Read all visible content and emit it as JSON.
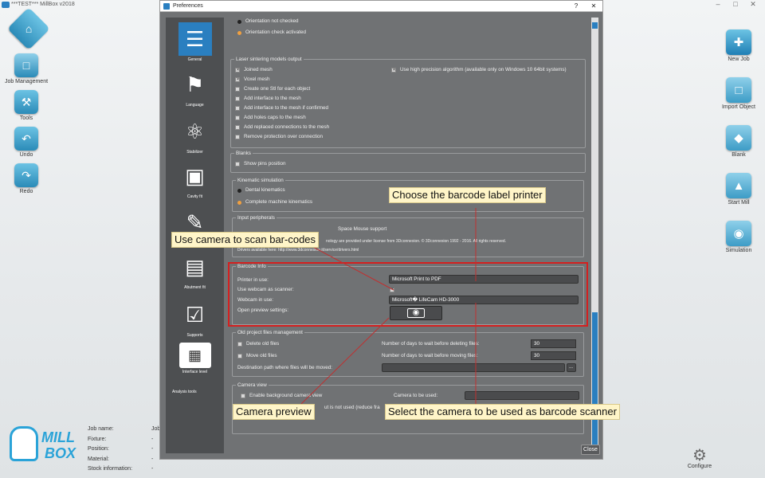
{
  "app": {
    "title": "***TEST*** MillBox v2018"
  },
  "window_controls": [
    "–",
    "□",
    "✕"
  ],
  "left_toolbar": [
    {
      "label": "",
      "icon": "home-icon"
    },
    {
      "label": "Job Management",
      "icon": "job-management-icon"
    },
    {
      "label": "Tools",
      "icon": "tools-icon"
    },
    {
      "label": "Undo",
      "icon": "undo-icon"
    },
    {
      "label": "Redo",
      "icon": "redo-icon"
    }
  ],
  "right_toolbar": [
    {
      "label": "New Job",
      "icon": "new-job-icon"
    },
    {
      "label": "Import Object",
      "icon": "import-object-icon"
    },
    {
      "label": "Blank",
      "icon": "blank-icon"
    },
    {
      "label": "Start Mill",
      "icon": "start-mill-icon"
    },
    {
      "label": "Simulation",
      "icon": "simulation-icon"
    }
  ],
  "job_info": [
    {
      "key": "Job name:",
      "value": "Job"
    },
    {
      "key": "Fixture:",
      "value": "-"
    },
    {
      "key": "Position:",
      "value": "-"
    },
    {
      "key": "Material:",
      "value": "-"
    },
    {
      "key": "Stock information:",
      "value": "-"
    }
  ],
  "logo": {
    "line1": "MILL",
    "line2": "BOX"
  },
  "configure": {
    "label": "Configure"
  },
  "dialog": {
    "title": "Preferences",
    "help": "?",
    "close_x": "✕",
    "close_button": "Close",
    "nav": [
      {
        "label": "General",
        "icon": "sliders-icon"
      },
      {
        "label": "Language",
        "icon": "flag-icon"
      },
      {
        "label": "Stabilizer",
        "icon": "stabilizer-icon"
      },
      {
        "label": "Cavity fit",
        "icon": "cavity-fit-icon"
      },
      {
        "label": "",
        "icon": "pencil-box-icon"
      },
      {
        "label": "Abutment fit",
        "icon": "abutment-icon"
      },
      {
        "label": "Supports",
        "icon": "supports-icon"
      },
      {
        "label": "Interface level",
        "icon": "interface-level-icon"
      },
      {
        "label": "Analysis tools",
        "icon": ""
      }
    ],
    "orientation": {
      "not_checked": "Orientation not checked",
      "activated": "Orientation check activated"
    },
    "laser": {
      "title": "Laser sintering models output",
      "joined": "Joined mesh",
      "high_precision": "Use high precision algorithm (available only on Windows 10 64bit systems)",
      "voxel": "Voxel mesh",
      "one_stl": "Create one Stl for each object",
      "add_interface": "Add interface to the mesh",
      "add_interface_confirmed": "Add interface to the mesh if confirmed",
      "holes_caps": "Add holes caps to the mesh",
      "replaced_conn": "Add replaced connections to the mesh",
      "remove_protection": "Remove protection over connection"
    },
    "blanks": {
      "title": "Blanks",
      "show_pins": "Show pins position"
    },
    "kinematic": {
      "title": "Kinematic simulation",
      "dental": "Dental kinematics",
      "complete": "Complete machine kinematics"
    },
    "input": {
      "title": "Input peripherals",
      "support_tail": "Space Mouse support",
      "license_text": "nology are provided under license from 3Dconnexion. © 3Dconnexion 1992 - 2016. All rights reserved.",
      "drivers": "Drivers available here: http://www.3dconnexion.it/service/drivers.html"
    },
    "barcode": {
      "title": "Barcode Info",
      "printer_label": "Printer in use:",
      "printer_value": "Microsoft Print to PDF",
      "webcam_scanner_label": "Use webcam as scanner:",
      "webcam_label": "Webcam in use:",
      "webcam_value": "Microsoft� LifeCam HD-3000",
      "preview_label": "Open preview settings:"
    },
    "old_files": {
      "title": "Old project files management",
      "delete": "Delete old files",
      "delete_days_label": "Number of days to wait before deleting files:",
      "delete_days": "30",
      "move": "Move old files",
      "move_days_label": "Number of days to wait before moving files:",
      "move_days": "30",
      "dest_label": "Destination path where files will be moved:",
      "browse": "..."
    },
    "camera": {
      "title": "Camera view",
      "enable": "Enable background camera view",
      "camera_label": "Camera to be used:",
      "reduce_text": "ut is not used (reduce fra"
    }
  },
  "annotations": {
    "printer": "Choose the barcode label printer",
    "scan": "Use camera to scan bar-codes",
    "preview": "Camera preview",
    "select_camera": "Select the camera to be used as barcode scanner"
  },
  "colors": {
    "accent": "#2a7fc0",
    "annotation_line": "#c03030",
    "highlight_box": "#d42020",
    "annotation_bg": "#fff5c8"
  }
}
